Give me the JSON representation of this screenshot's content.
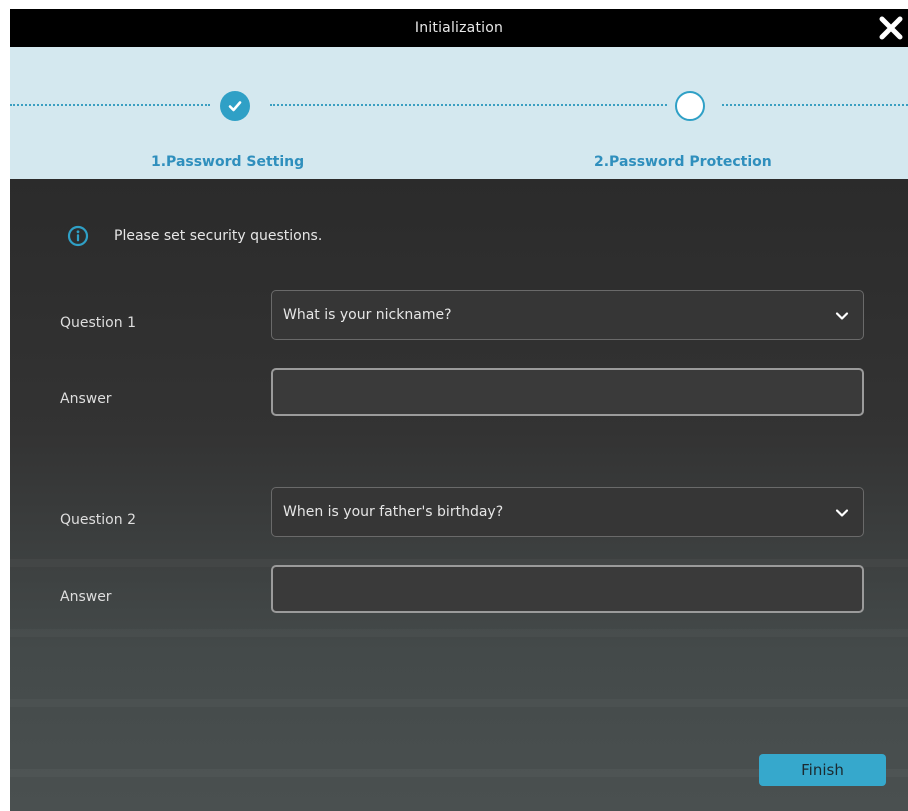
{
  "window": {
    "title": "Initialization"
  },
  "steps": [
    {
      "label": "1.Password Setting",
      "state": "done"
    },
    {
      "label": "2.Password Protection",
      "state": "current"
    }
  ],
  "info": {
    "text": "Please set security questions."
  },
  "form": {
    "question1": {
      "label": "Question 1",
      "selected": "What is your nickname?"
    },
    "answer1": {
      "label": "Answer",
      "value": ""
    },
    "question2": {
      "label": "Question 2",
      "selected": "When is your father's birthday?"
    },
    "answer2": {
      "label": "Answer",
      "value": ""
    }
  },
  "buttons": {
    "finish": "Finish"
  },
  "colors": {
    "accent": "#2fa0c6",
    "step_bar": "#d4e8ef",
    "title_bar": "#000000",
    "panel": "#303030"
  },
  "icons": {
    "close": "close-icon",
    "check": "check-icon",
    "info": "info-icon",
    "dropdown": "chevron-down-icon"
  }
}
